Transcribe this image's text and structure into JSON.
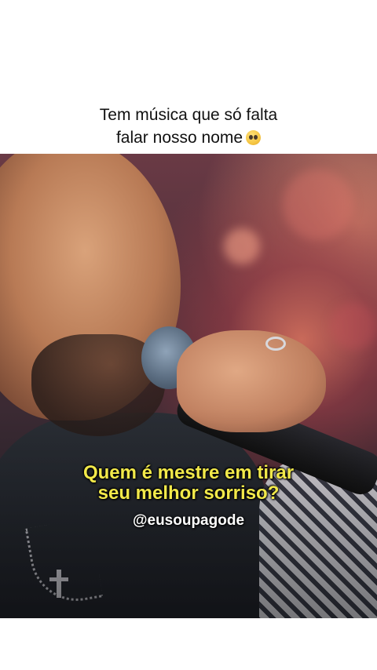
{
  "caption": {
    "line1": "Tem música que só falta",
    "line2": "falar nosso nome",
    "emoji": "pleading-face"
  },
  "video": {
    "subtitle_line1": "Quem é mestre em tirar",
    "subtitle_line2": "seu melhor sorriso?",
    "handle": "@eusoupagode",
    "subtitle_color": "#f2e94a"
  }
}
